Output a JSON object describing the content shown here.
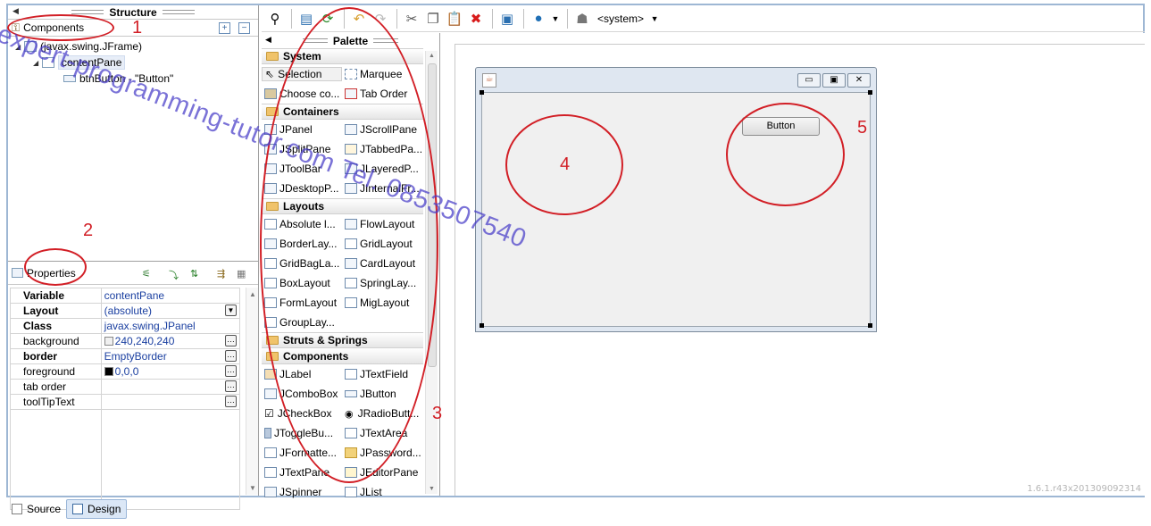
{
  "structure": {
    "title": "Structure",
    "components_label": "Components",
    "tree": {
      "root": "(javax.swing.JFrame)",
      "child": "contentPane",
      "leaf": "btnButton - \"Button\""
    }
  },
  "properties": {
    "title": "Properties",
    "rows": [
      {
        "key": "Variable",
        "value": "contentPane",
        "bold": true
      },
      {
        "key": "Layout",
        "value": "(absolute)",
        "bold": true
      },
      {
        "key": "Class",
        "value": "javax.swing.JPanel",
        "bold": true
      },
      {
        "key": "background",
        "value": "240,240,240",
        "swatch": "#f0f0f0"
      },
      {
        "key": "border",
        "value": "EmptyBorder",
        "bold": true
      },
      {
        "key": "foreground",
        "value": "0,0,0",
        "swatch": "#000000"
      },
      {
        "key": "tab order",
        "value": ""
      },
      {
        "key": "toolTipText",
        "value": ""
      }
    ]
  },
  "toolbar": {
    "system_label": "<system>"
  },
  "palette": {
    "title": "Palette",
    "categories": {
      "system": "System",
      "containers": "Containers",
      "layouts": "Layouts",
      "struts": "Struts & Springs",
      "components": "Components"
    },
    "system_items": [
      "Selection",
      "Marquee",
      "Choose co...",
      "Tab Order"
    ],
    "container_items": [
      "JPanel",
      "JScrollPane",
      "JSplitPane",
      "JTabbedPa...",
      "JToolBar",
      "JLayeredP...",
      "JDesktopP...",
      "JInternalFr..."
    ],
    "layout_items": [
      "Absolute l...",
      "FlowLayout",
      "BorderLay...",
      "GridLayout",
      "GridBagLa...",
      "CardLayout",
      "BoxLayout",
      "SpringLay...",
      "FormLayout",
      "MigLayout",
      "GroupLay..."
    ],
    "component_items": [
      "JLabel",
      "JTextField",
      "JComboBox",
      "JButton",
      "JCheckBox",
      "JRadioButt...",
      "JToggleBu...",
      "JTextArea",
      "JFormatte...",
      "JPassword...",
      "JTextPane",
      "JEditorPane",
      "JSpinner",
      "JList"
    ]
  },
  "design": {
    "button_label": "Button",
    "version": "1.6.1.r43x201309092314"
  },
  "bottom_tabs": {
    "source": "Source",
    "design": "Design"
  },
  "annotations": {
    "n1": "1",
    "n2": "2",
    "n3": "3",
    "n4": "4",
    "n5": "5",
    "watermark": "expert-programming-tutor.com Tel. 0853507540",
    "color": "#d21f26"
  }
}
